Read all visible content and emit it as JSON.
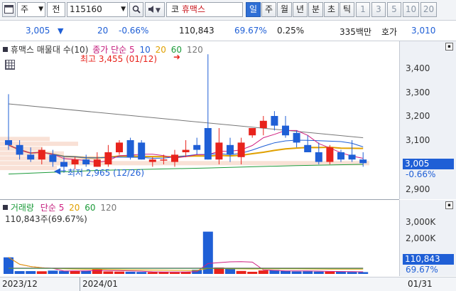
{
  "toolbar": {
    "market": "주",
    "type": "전",
    "code": "115160",
    "stock_name": "휴맥스",
    "market_prefix": "코",
    "periods": [
      "일",
      "주",
      "월",
      "년",
      "분",
      "초",
      "틱"
    ],
    "active_period": "일",
    "intervals": [
      "1",
      "3",
      "5",
      "10",
      "20"
    ]
  },
  "quote": {
    "price": "3,005",
    "change": "20",
    "change_pct": "-0.66%",
    "volume": "110,843",
    "vol_ratio": "69.67%",
    "turnover": "0.25%",
    "amount": "335백만",
    "ask_label": "호가",
    "ask_price": "3,010"
  },
  "price_chart": {
    "legend_name": "휴맥스 매물대 수(10)",
    "legend_close": "종가 단순",
    "ma_periods": [
      "5",
      "10",
      "20",
      "60",
      "120"
    ],
    "high_label": "최고 3,455 (01/12)",
    "low_label": "최저 2,965 (12/26)",
    "y_ticks": [
      "3,400",
      "3,300",
      "3,200",
      "3,100",
      "2,900"
    ],
    "last_price": "3,005",
    "last_change": "-0.66%"
  },
  "volume_chart": {
    "legend": "거래량",
    "ma_label": "단순",
    "ma_periods": [
      "5",
      "20",
      "60",
      "120"
    ],
    "current_label": "110,843주(69.67%)",
    "y_ticks": [
      "3,000K",
      "2,000K"
    ],
    "last_volume": "110,843",
    "last_pct": "69.67%"
  },
  "dates": {
    "left": "2023/12",
    "mid": "2024/01",
    "right": "01/31"
  },
  "colors": {
    "up": "#e8231c",
    "down": "#1f5fd6",
    "selected": "#2f6fd6"
  },
  "chart_data": {
    "type": "candlestick",
    "ohlc": [
      [
        3100,
        3290,
        3060,
        3080
      ],
      [
        3080,
        3100,
        3020,
        3040
      ],
      [
        3040,
        3070,
        3010,
        3020
      ],
      [
        3020,
        3070,
        3000,
        3060
      ],
      [
        3040,
        3060,
        2990,
        3010
      ],
      [
        3010,
        3030,
        2965,
        2990
      ],
      [
        3000,
        3030,
        2980,
        3020
      ],
      [
        3020,
        3040,
        2990,
        3000
      ],
      [
        2990,
        3050,
        2990,
        3020
      ],
      [
        3000,
        3080,
        2990,
        3050
      ],
      [
        3050,
        3100,
        3040,
        3090
      ],
      [
        3100,
        3110,
        3020,
        3030
      ],
      [
        3090,
        3100,
        3020,
        3020
      ],
      [
        3010,
        3030,
        2990,
        3020
      ],
      [
        3020,
        3040,
        3000,
        3020
      ],
      [
        3010,
        3060,
        2990,
        3040
      ],
      [
        3050,
        3100,
        3030,
        3060
      ],
      [
        3080,
        3110,
        3040,
        3060
      ],
      [
        3150,
        3455,
        3020,
        3020
      ],
      [
        3020,
        3150,
        3000,
        3090
      ],
      [
        3080,
        3110,
        3010,
        3040
      ],
      [
        3030,
        3110,
        3000,
        3090
      ],
      [
        3120,
        3150,
        3110,
        3150
      ],
      [
        3150,
        3200,
        3120,
        3180
      ],
      [
        3200,
        3220,
        3140,
        3160
      ],
      [
        3160,
        3200,
        3110,
        3120
      ],
      [
        3130,
        3140,
        3070,
        3090
      ],
      [
        3080,
        3120,
        3050,
        3050
      ],
      [
        3050,
        3090,
        3000,
        3010
      ],
      [
        3010,
        3080,
        3000,
        3070
      ],
      [
        3050,
        3060,
        3010,
        3020
      ],
      [
        3040,
        3100,
        3010,
        3020
      ],
      [
        3020,
        3050,
        2990,
        3005
      ]
    ],
    "volume_k": [
      1000,
      170,
      170,
      160,
      200,
      180,
      190,
      200,
      300,
      150,
      140,
      130,
      120,
      110,
      110,
      100,
      130,
      250,
      2550,
      390,
      320,
      180,
      130,
      210,
      230,
      180,
      150,
      160,
      140,
      140,
      130,
      120,
      110
    ]
  }
}
